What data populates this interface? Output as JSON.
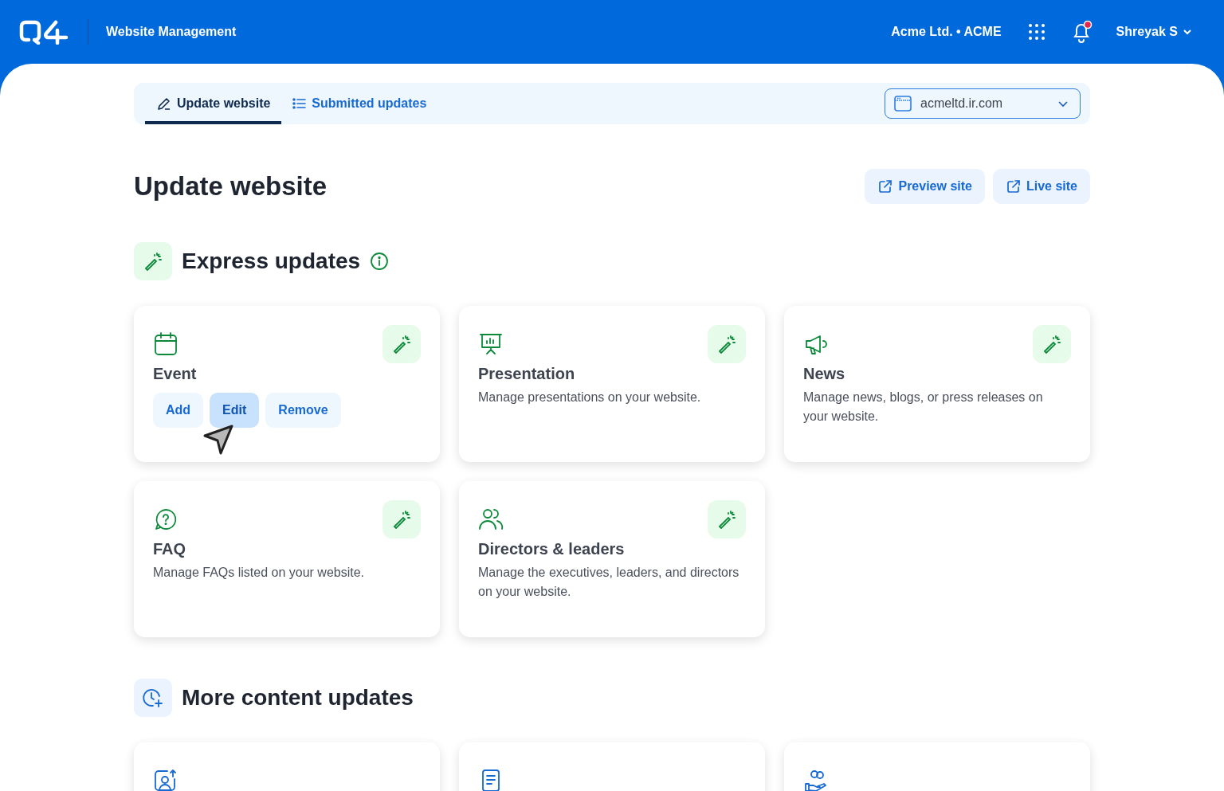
{
  "header": {
    "app_title": "Website Management",
    "org": "Acme Ltd. • ACME",
    "notifications_unread": true,
    "user": "Shreyak S"
  },
  "tabs": [
    {
      "label": "Update website",
      "kind": "pen",
      "selected": true
    },
    {
      "label": "Submitted updates",
      "kind": "list",
      "selected": false
    }
  ],
  "site_select": {
    "value": "acmeltd.ir.com"
  },
  "page_title": "Update website",
  "page_actions": [
    "Preview site",
    "Live site"
  ],
  "express": {
    "title": "Express updates",
    "cards": [
      {
        "kind": "calendar",
        "title": "Event",
        "actions": [
          {
            "label": "Add",
            "selected": false
          },
          {
            "label": "Edit",
            "selected": true
          },
          {
            "label": "Remove",
            "selected": false
          }
        ]
      },
      {
        "kind": "presentation",
        "title": "Presentation",
        "description": "Manage presentations on your website."
      },
      {
        "kind": "megaphone",
        "title": "News",
        "description": "Manage news, blogs, or press releases on your website."
      },
      {
        "kind": "question",
        "title": "FAQ",
        "description": "Manage FAQs listed on your website."
      },
      {
        "kind": "people",
        "title": "Directors & leaders",
        "description": "Manage the executives, leaders, and directors on your website."
      }
    ]
  },
  "more": {
    "title": "More content updates",
    "cards": [
      {
        "kind": "user-upload"
      },
      {
        "kind": "document"
      },
      {
        "kind": "hand"
      }
    ]
  }
}
